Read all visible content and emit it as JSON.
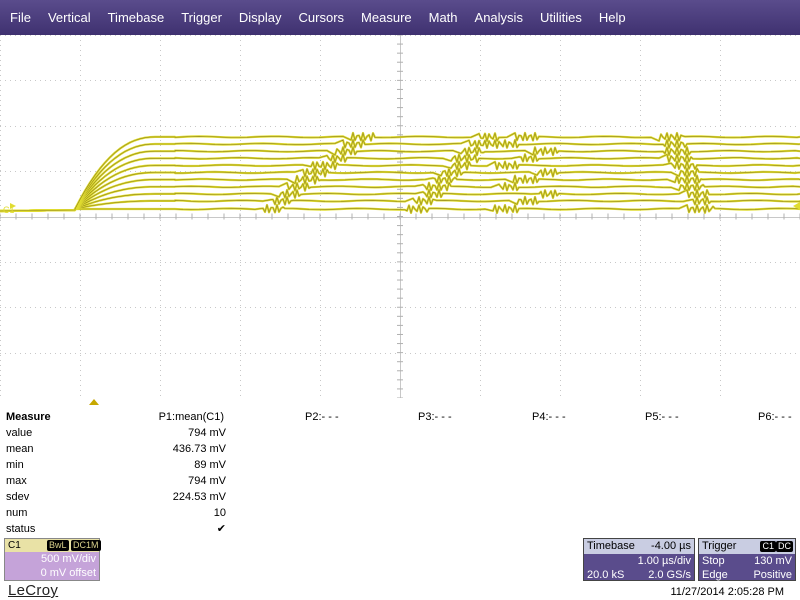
{
  "menu": [
    "File",
    "Vertical",
    "Timebase",
    "Trigger",
    "Display",
    "Cursors",
    "Measure",
    "Math",
    "Analysis",
    "Utilities",
    "Help"
  ],
  "screen": {
    "channel_label": "C1",
    "trace_color": "#e0dc30",
    "traces_mV": [
      0,
      89,
      166,
      245,
      324,
      402,
      480,
      559,
      637,
      716,
      794
    ]
  },
  "measure": {
    "title": "Measure",
    "params": [
      "P1:mean(C1)",
      "P2:- - -",
      "P3:- - -",
      "P4:- - -",
      "P5:- - -",
      "P6:- - -"
    ],
    "rows": [
      {
        "label": "value",
        "value": "794 mV"
      },
      {
        "label": "mean",
        "value": "436.73 mV"
      },
      {
        "label": "min",
        "value": "89 mV"
      },
      {
        "label": "max",
        "value": "794 mV"
      },
      {
        "label": "sdev",
        "value": "224.53 mV"
      },
      {
        "label": "num",
        "value": "10"
      },
      {
        "label": "status",
        "value": "✔"
      }
    ]
  },
  "channel": {
    "name": "C1",
    "bwl": "BwL",
    "coupling": "DC1M",
    "vdiv": "500 mV/div",
    "offset": "0 mV offset"
  },
  "timebase": {
    "title": "Timebase",
    "delay": "-4.00 µs",
    "tdiv": "1.00 µs/div",
    "samples": "20.0 kS",
    "rate": "2.0 GS/s"
  },
  "trigger": {
    "title": "Trigger",
    "badge_ch": "C1",
    "badge_coupling": "DC",
    "mode": "Stop",
    "level": "130 mV",
    "type": "Edge",
    "slope": "Positive"
  },
  "brand": "LeCroy",
  "datetime": "11/27/2014 2:05:28 PM"
}
